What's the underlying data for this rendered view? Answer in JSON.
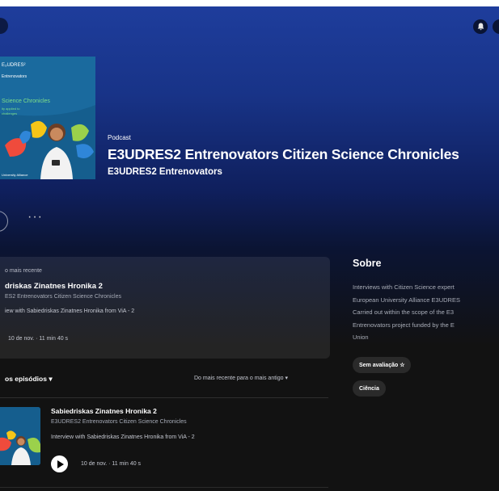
{
  "colors": {
    "header_blue": "#1e3d9c",
    "background": "#121212",
    "cover_teal": "#155e8e"
  },
  "topbar": {
    "notification_icon": "bell-icon",
    "profile_icon": "user-icon"
  },
  "cover": {
    "logo_top": "E₃UDRES²",
    "logo_sub": "Entrenovators",
    "series": "Citizen Science Chronicles"
  },
  "hero": {
    "type_label": "Podcast",
    "title": "E3UDRES2 Entrenovators Citizen Science Chronicles",
    "author": "E3UDRES2 Entrenovators"
  },
  "actions": {
    "more_label": "···"
  },
  "latest": {
    "label": "o mais recente",
    "title": "driskas Zinatnes Hronika 2",
    "show": "ES2 Entrenovators Citizen Science Chronicles",
    "description": "iew with Sabiedriskas Zinatnes Hronika from ViA - 2",
    "meta": "10 de nov. · 11 min 40 s"
  },
  "about": {
    "heading": "Sobre",
    "text": "Interviews with Citizen Science expert\nEuropean University Alliance E3UDRES\nCarried out within the scope of the E3\nEntrenovators project funded by the E\nUnion",
    "rating_label": "Sem avaliação ☆",
    "category_label": "Ciência"
  },
  "episodes": {
    "header": "os episódios ▾",
    "sort_label": "Do mais recente para o mais antigo ▾",
    "items": [
      {
        "title": "Sabiedriskas Zinatnes Hronika 2",
        "show": "E3UDRES2 Entrenovators Citizen Science Chronicles",
        "description": "Interview with Sabiedriskas Zinatnes Hronika from ViA - 2",
        "meta": "10 de nov. · 11 min 40 s"
      }
    ]
  }
}
